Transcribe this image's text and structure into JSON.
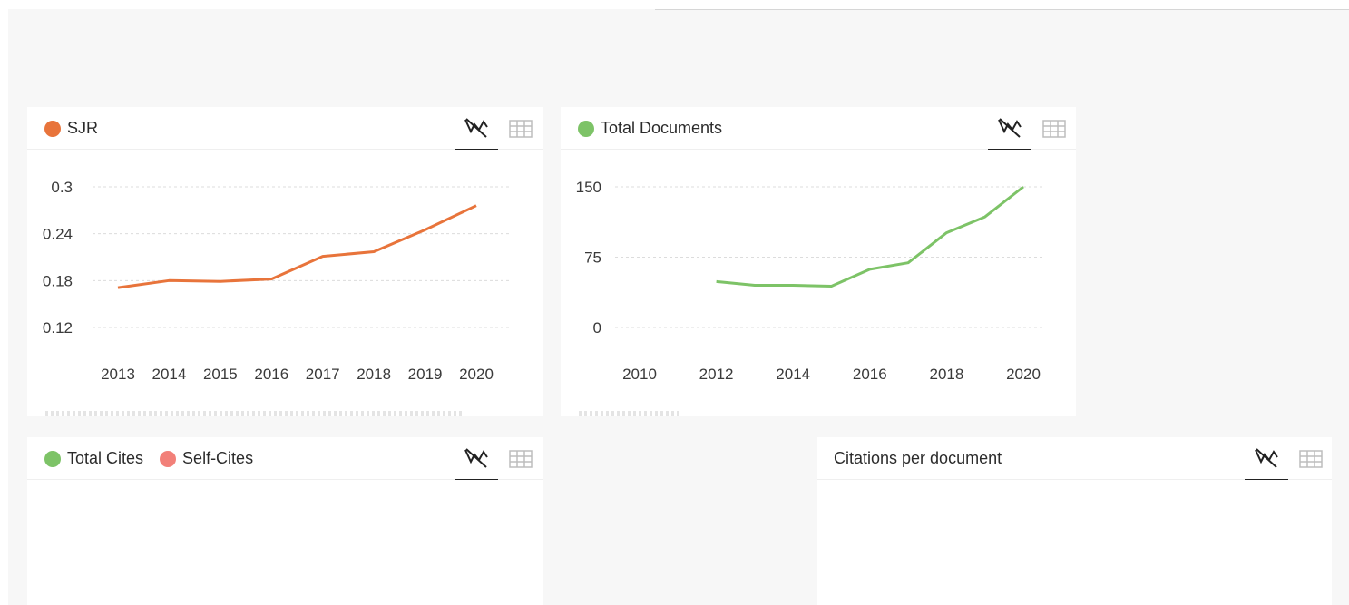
{
  "cards": {
    "sjr": {
      "legend": [
        {
          "label": "SJR",
          "color": "#e8743b"
        }
      ],
      "tools": [
        "chart-icon",
        "table-icon"
      ],
      "chart_data": {
        "type": "line",
        "x": [
          "2013",
          "2014",
          "2015",
          "2016",
          "2017",
          "2018",
          "2019",
          "2020"
        ],
        "series": [
          {
            "name": "SJR",
            "color": "#e8743b",
            "values": [
              0.171,
              0.18,
              0.179,
              0.182,
              0.211,
              0.217,
              0.245,
              0.276
            ]
          }
        ],
        "yticks": [
          "0.3",
          "0.24",
          "0.18",
          "0.12"
        ],
        "ylim": [
          0.12,
          0.3
        ],
        "grid": true
      }
    },
    "docs": {
      "legend": [
        {
          "label": "Total Documents",
          "color": "#7dc367"
        }
      ],
      "tools": [
        "chart-icon",
        "table-icon"
      ],
      "chart_data": {
        "type": "line",
        "x": [
          "2012",
          "2013",
          "2014",
          "2015",
          "2016",
          "2017",
          "2018",
          "2019",
          "2020"
        ],
        "xticks": [
          "2010",
          "2012",
          "2014",
          "2016",
          "2018",
          "2020"
        ],
        "xlim": [
          2010,
          2020
        ],
        "series": [
          {
            "name": "Total Documents",
            "color": "#7dc367",
            "values": [
              49,
              45,
              45,
              44,
              62,
              69,
              101,
              118,
              150
            ]
          }
        ],
        "yticks": [
          "150",
          "75",
          "0"
        ],
        "ylim": [
          0,
          150
        ],
        "grid": true
      }
    },
    "cites": {
      "legend": [
        {
          "label": "Total Cites",
          "color": "#7dc367"
        },
        {
          "label": "Self-Cites",
          "color": "#f28079"
        }
      ],
      "tools": [
        "chart-icon",
        "table-icon"
      ]
    },
    "cpd": {
      "title": "Citations per document",
      "tools": [
        "chart-icon",
        "table-icon"
      ]
    }
  },
  "colors": {
    "accent_orange": "#e8743b",
    "accent_green": "#7dc367",
    "accent_red": "#f28079"
  }
}
